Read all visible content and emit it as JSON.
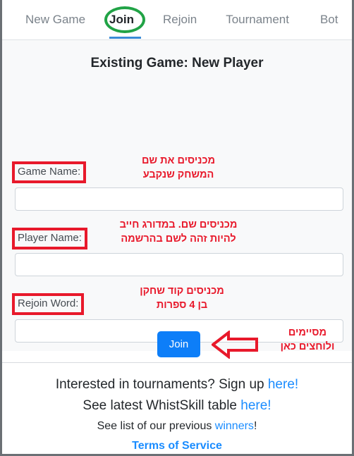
{
  "tabs": [
    {
      "id": "new-game",
      "label": "New Game",
      "active": false
    },
    {
      "id": "join",
      "label": "Join",
      "active": true
    },
    {
      "id": "rejoin",
      "label": "Rejoin",
      "active": false
    },
    {
      "id": "tournament",
      "label": "Tournament",
      "active": false
    },
    {
      "id": "bot",
      "label": "Bot",
      "active": false
    }
  ],
  "form": {
    "title": "Existing Game: New Player",
    "fields": [
      {
        "label": "Game Name:",
        "value": "",
        "placeholder": "",
        "note": "מכניסים את שם\nהמשחק שנקבע"
      },
      {
        "label": "Player Name:",
        "value": "",
        "placeholder": "",
        "note": "מכניסים שם. במדורג חייב\nלהיות זהה לשם בהרשמה"
      },
      {
        "label": "Rejoin Word:",
        "value": "",
        "placeholder": "",
        "note": "מכניסים קוד שחקן\nבן 4 ספרות"
      }
    ],
    "submit_label": "Join",
    "submit_note": "מסיימים\nולוחצים כאן"
  },
  "footer": {
    "line1_pre": "Interested in tournaments? Sign up ",
    "line1_link": "here!",
    "line2_pre": "See latest WhistSkill table ",
    "line2_link": "here!",
    "line3_pre": "See list of our previous ",
    "line3_link": "winners",
    "line3_post": "!",
    "line4_link": "Terms of Service"
  },
  "colors": {
    "accent_blue": "#0d7ef8",
    "link_blue": "#1a8cff",
    "annotation_red": "#e8192b",
    "highlight_green": "#21a346",
    "tab_underline": "#3b8bd6",
    "panel_bg": "#f8f9fa"
  }
}
